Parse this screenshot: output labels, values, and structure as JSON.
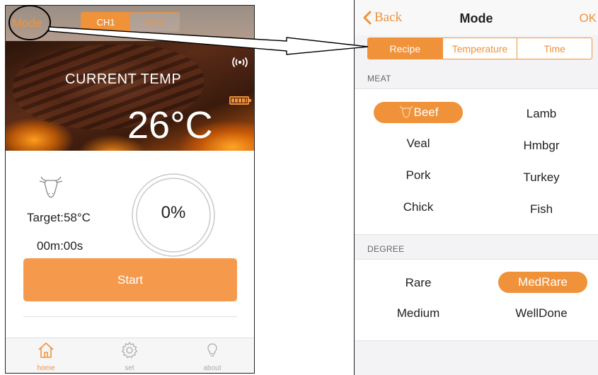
{
  "left_screen": {
    "header": {
      "mode_label": "Mode",
      "channel_tabs": [
        "CH1",
        "CH2"
      ]
    },
    "hero": {
      "current_temp_label": "CURRENT TEMP",
      "temperature": "26°C"
    },
    "target_label": "Target:58°C",
    "timer": "00m:00s",
    "progress": "0%",
    "start_label": "Start",
    "tabbar": {
      "home": "home",
      "set": "set",
      "about": "about"
    }
  },
  "right_screen": {
    "nav": {
      "back_label": "Back",
      "title": "Mode",
      "ok_label": "OK"
    },
    "segments": [
      "Recipe",
      "Temperature",
      "Time"
    ],
    "meat_header": "MEAT",
    "meats": [
      "Beef",
      "Lamb",
      "Veal",
      "Hmbgr",
      "Pork",
      "Turkey",
      "Chick",
      "Fish"
    ],
    "degree_header": "DEGREE",
    "degrees": [
      "Rare",
      "MedRare",
      "Medium",
      "WellDone"
    ]
  },
  "colors": {
    "accent": "#f0923a",
    "button": "#f59a4d"
  }
}
